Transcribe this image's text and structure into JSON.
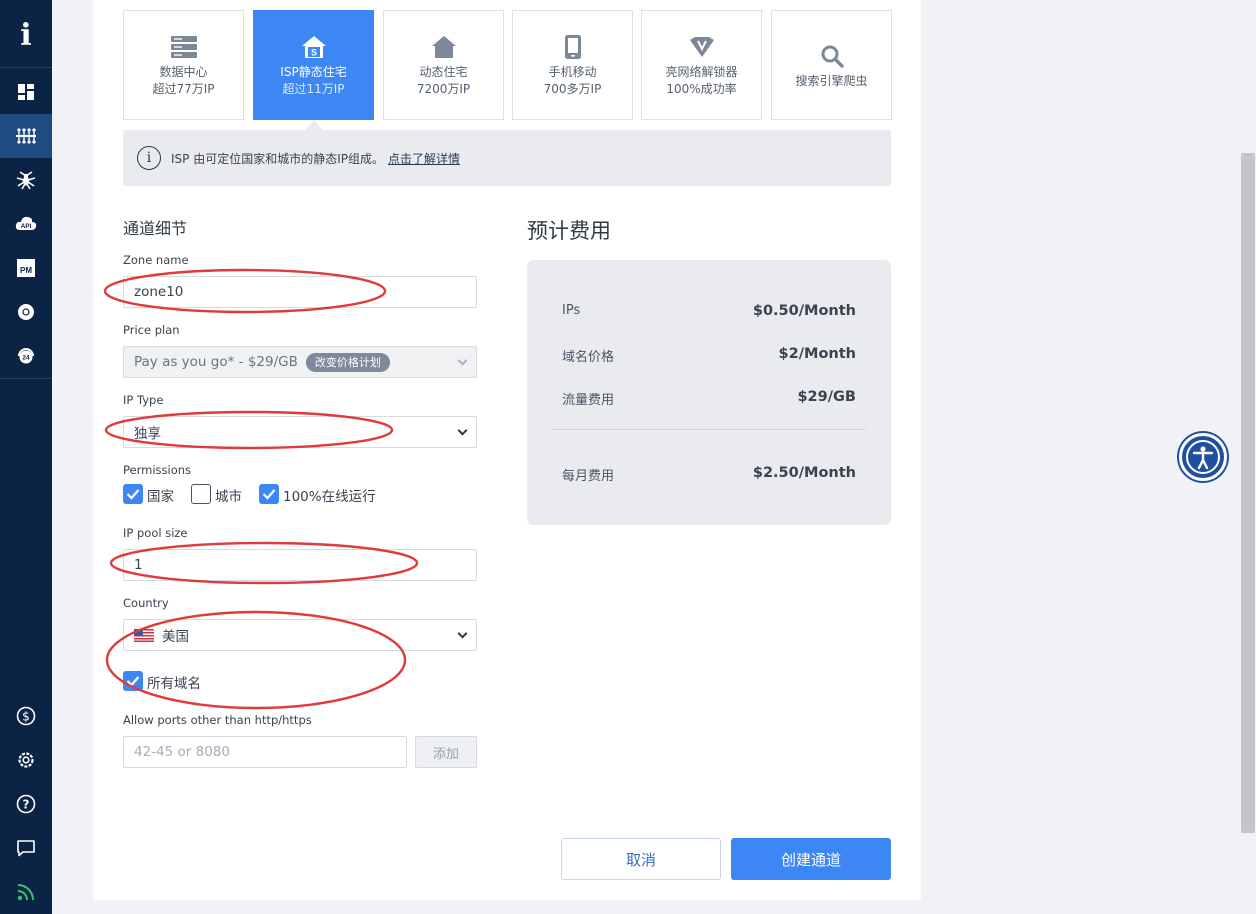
{
  "sidebar": {
    "logo": "i",
    "items": [
      {
        "icon": "dashboard-icon"
      },
      {
        "icon": "proxy-network-icon",
        "active": true
      },
      {
        "icon": "spider-icon"
      },
      {
        "icon": "api-icon",
        "text": "API"
      },
      {
        "icon": "proxy-manager-icon",
        "text": "PM"
      },
      {
        "icon": "chrome-icon"
      },
      {
        "icon": "support-24-icon",
        "text": "24"
      }
    ],
    "bottom_items": [
      {
        "icon": "billing-icon"
      },
      {
        "icon": "settings-icon"
      },
      {
        "icon": "help-icon"
      },
      {
        "icon": "chat-icon"
      },
      {
        "icon": "feed-icon"
      }
    ]
  },
  "product_tiles": [
    {
      "title": "数据中心",
      "subtitle": "超过77万IP",
      "icon": "server-icon"
    },
    {
      "title": "ISP静态住宅",
      "subtitle": "超过11万IP",
      "icon": "house-s-icon",
      "active": true
    },
    {
      "title": "动态住宅",
      "subtitle": "7200万IP",
      "icon": "house-icon"
    },
    {
      "title": "手机移动",
      "subtitle": "700多万IP",
      "icon": "mobile-icon"
    },
    {
      "title": "亮网络解锁器",
      "subtitle": "100%成功率",
      "icon": "unlocker-icon"
    },
    {
      "title": "搜索引擎爬虫",
      "subtitle": "",
      "icon": "search-icon"
    }
  ],
  "info_bar": {
    "text": "ISP 由可定位国家和城市的静态IP组成。",
    "link": "点击了解详情"
  },
  "form": {
    "section_title": "通道细节",
    "zone_name": {
      "label": "Zone name",
      "value": "zone10"
    },
    "price_plan": {
      "label": "Price plan",
      "value": "Pay as you go* - $29/GB",
      "pill": "改变价格计划"
    },
    "ip_type": {
      "label": "IP Type",
      "value": "独享"
    },
    "permissions": {
      "label": "Permissions",
      "options": [
        {
          "label": "国家",
          "checked": true
        },
        {
          "label": "城市",
          "checked": false
        },
        {
          "label": "100%在线运行",
          "checked": true
        }
      ]
    },
    "ip_pool_size": {
      "label": "IP pool size",
      "value": "1"
    },
    "country": {
      "label": "Country",
      "value": "美国"
    },
    "all_domains": {
      "label": "所有域名",
      "checked": true
    },
    "ports": {
      "label": "Allow ports other than http/https",
      "placeholder": "42-45 or 8080",
      "add_label": "添加"
    }
  },
  "cost": {
    "title": "预计费用",
    "rows": [
      {
        "label": "IPs",
        "value": "$0.50/Month"
      },
      {
        "label": "域名价格",
        "value": "$2/Month"
      },
      {
        "label": "流量费用",
        "value": "$29/GB"
      }
    ],
    "total": {
      "label": "每月费用",
      "value": "$2.50/Month"
    }
  },
  "actions": {
    "cancel": "取消",
    "create": "创建通道"
  },
  "colors": {
    "accent": "#3d87f5",
    "sidebar": "#0b2344",
    "annotation": "#e03a3a"
  }
}
